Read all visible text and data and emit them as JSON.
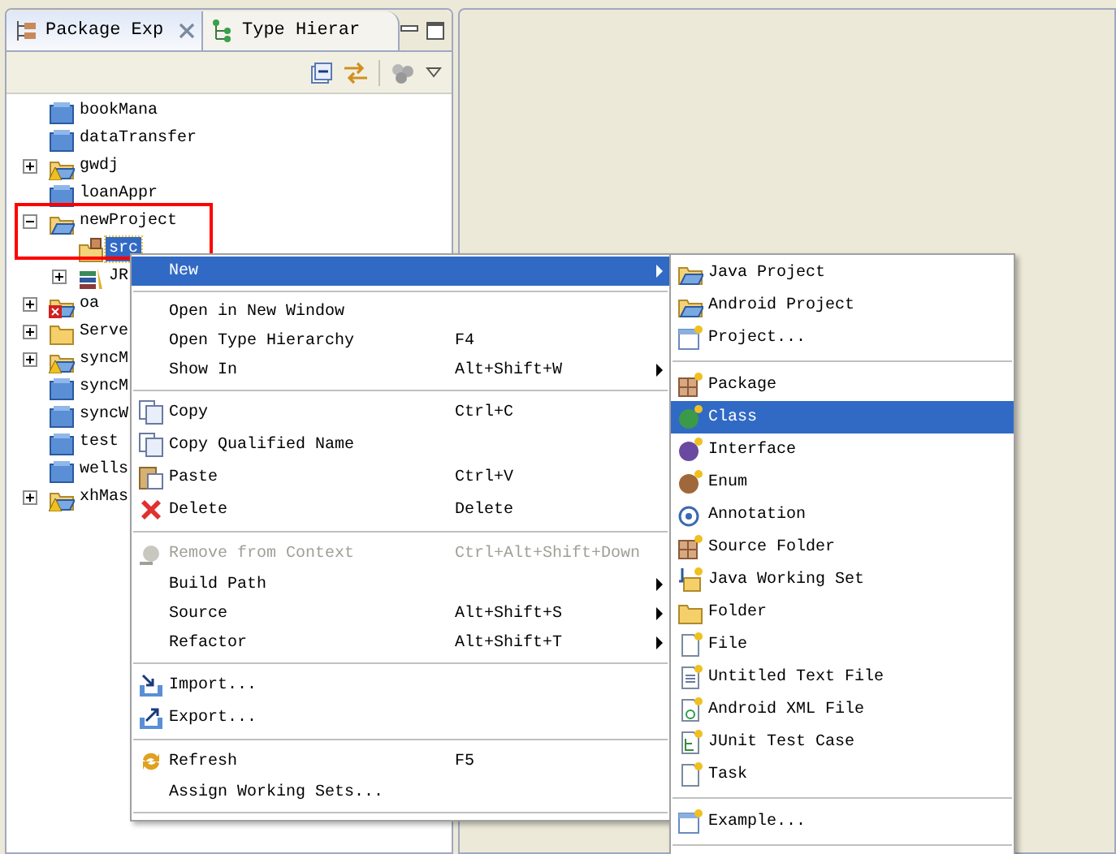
{
  "tabs": [
    {
      "label": "Package Exp",
      "selected": true
    },
    {
      "label": "Type Hierar",
      "selected": false
    }
  ],
  "tree": [
    {
      "label": "bookMana",
      "kind": "project",
      "selected": false
    },
    {
      "label": "dataTransfer",
      "kind": "project",
      "selected": false
    },
    {
      "label": "gwdj",
      "kind": "java-project-warning",
      "expanded": false,
      "selected": false
    },
    {
      "label": "loanAppr",
      "kind": "project",
      "selected": false
    },
    {
      "label": "newProject",
      "kind": "java-project",
      "expanded": true,
      "selected": false,
      "children": [
        {
          "label": "src",
          "kind": "package-folder",
          "selected": true
        },
        {
          "label": "JR",
          "kind": "library",
          "expanded": false,
          "selected": false
        }
      ]
    },
    {
      "label": "oa",
      "kind": "java-project-error",
      "expanded": false,
      "selected": false
    },
    {
      "label": "Serve",
      "kind": "folder",
      "expanded": false,
      "selected": false
    },
    {
      "label": "syncM",
      "kind": "java-project-warning",
      "expanded": false,
      "selected": false
    },
    {
      "label": "syncM",
      "kind": "project",
      "selected": false
    },
    {
      "label": "syncW",
      "kind": "project",
      "selected": false
    },
    {
      "label": "test",
      "kind": "project",
      "selected": false
    },
    {
      "label": "wells",
      "kind": "project",
      "selected": false
    },
    {
      "label": "xhMas",
      "kind": "java-project-warning",
      "expanded": false,
      "selected": false
    }
  ],
  "context_menu": [
    {
      "kind": "plain",
      "label": "New",
      "submenu": true,
      "selected": true,
      "disabled": false
    },
    {
      "kind": "separator"
    },
    {
      "kind": "plain",
      "label": "Open in New Window",
      "submenu": false,
      "selected": false,
      "disabled": false
    },
    {
      "kind": "plain",
      "label": "Open Type Hierarchy",
      "shortcut": "F4",
      "submenu": false,
      "selected": false,
      "disabled": false
    },
    {
      "kind": "plain",
      "label": "Show In",
      "shortcut": "Alt+Shift+W",
      "submenu": true,
      "selected": false,
      "disabled": false
    },
    {
      "kind": "separator"
    },
    {
      "kind": "copy",
      "label": "Copy",
      "shortcut": "Ctrl+C",
      "submenu": false,
      "selected": false,
      "disabled": false
    },
    {
      "kind": "copy",
      "label": "Copy Qualified Name",
      "submenu": false,
      "selected": false,
      "disabled": false
    },
    {
      "kind": "paste",
      "label": "Paste",
      "shortcut": "Ctrl+V",
      "submenu": false,
      "selected": false,
      "disabled": false
    },
    {
      "kind": "delete",
      "label": "Delete",
      "shortcut": "Delete",
      "submenu": false,
      "selected": false,
      "disabled": false
    },
    {
      "kind": "separator"
    },
    {
      "kind": "remove",
      "label": "Remove from Context",
      "shortcut": "Ctrl+Alt+Shift+Down",
      "submenu": false,
      "selected": false,
      "disabled": true
    },
    {
      "kind": "plain",
      "label": "Build Path",
      "submenu": true,
      "selected": false,
      "disabled": false
    },
    {
      "kind": "plain",
      "label": "Source",
      "shortcut": "Alt+Shift+S",
      "submenu": true,
      "selected": false,
      "disabled": false
    },
    {
      "kind": "plain",
      "label": "Refactor",
      "shortcut": "Alt+Shift+T",
      "submenu": true,
      "selected": false,
      "disabled": false
    },
    {
      "kind": "separator"
    },
    {
      "kind": "import",
      "label": "Import...",
      "submenu": false,
      "selected": false,
      "disabled": false
    },
    {
      "kind": "export",
      "label": "Export...",
      "submenu": false,
      "selected": false,
      "disabled": false
    },
    {
      "kind": "separator"
    },
    {
      "kind": "refresh",
      "label": "Refresh",
      "shortcut": "F5",
      "submenu": false,
      "selected": false,
      "disabled": false
    },
    {
      "kind": "plain",
      "label": "Assign Working Sets...",
      "submenu": false,
      "selected": false,
      "disabled": false
    },
    {
      "kind": "separator"
    }
  ],
  "new_submenu": [
    {
      "kind": "java-project",
      "label": "Java Project",
      "selected": false
    },
    {
      "kind": "java-project",
      "label": "Android Project",
      "selected": false
    },
    {
      "kind": "wizard",
      "label": "Project...",
      "selected": false
    },
    {
      "kind": "separator"
    },
    {
      "kind": "package",
      "label": "Package",
      "selected": false
    },
    {
      "kind": "class",
      "label": "Class",
      "selected": true
    },
    {
      "kind": "interface",
      "label": "Interface",
      "selected": false
    },
    {
      "kind": "enum",
      "label": "Enum",
      "selected": false
    },
    {
      "kind": "annotation",
      "label": "Annotation",
      "selected": false
    },
    {
      "kind": "package",
      "label": "Source Folder",
      "selected": false
    },
    {
      "kind": "working-set",
      "label": "Java Working Set",
      "selected": false
    },
    {
      "kind": "folder",
      "label": "Folder",
      "selected": false
    },
    {
      "kind": "file",
      "label": "File",
      "selected": false
    },
    {
      "kind": "text-file",
      "label": "Untitled Text File",
      "selected": false
    },
    {
      "kind": "xml-file",
      "label": "Android XML File",
      "selected": false
    },
    {
      "kind": "junit",
      "label": "JUnit Test Case",
      "selected": false
    },
    {
      "kind": "file",
      "label": "Task",
      "selected": false
    },
    {
      "kind": "separator"
    },
    {
      "kind": "wizard",
      "label": "Example...",
      "selected": false
    },
    {
      "kind": "separator"
    }
  ]
}
